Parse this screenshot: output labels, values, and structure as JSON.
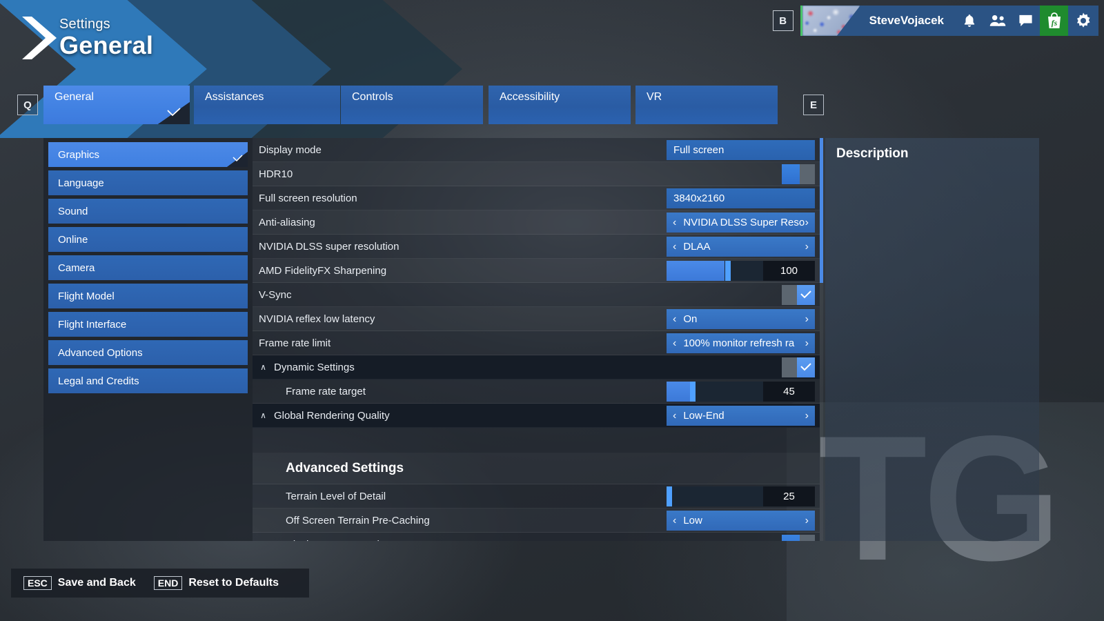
{
  "header": {
    "subtitle": "Settings",
    "title": "General"
  },
  "userbar": {
    "key_b": "B",
    "username": "SteveVojacek",
    "icons": [
      {
        "name": "bell-icon",
        "glyph": "☉"
      },
      {
        "name": "friends-icon",
        "glyph": "☉"
      },
      {
        "name": "chat-icon",
        "glyph": "☉"
      },
      {
        "name": "store-icon",
        "glyph": "fs"
      },
      {
        "name": "gear-icon",
        "glyph": "⚙"
      }
    ]
  },
  "tabs": {
    "key_prev": "Q",
    "key_next": "E",
    "items": [
      {
        "label": "General",
        "active": true
      },
      {
        "label": "Assistances",
        "active": false
      },
      {
        "label": "Controls",
        "active": false
      },
      {
        "label": "Accessibility",
        "active": false
      },
      {
        "label": "VR",
        "active": false
      }
    ]
  },
  "sidebar": {
    "items": [
      {
        "label": "Graphics",
        "active": true
      },
      {
        "label": "Language",
        "active": false
      },
      {
        "label": "Sound",
        "active": false
      },
      {
        "label": "Online",
        "active": false
      },
      {
        "label": "Camera",
        "active": false
      },
      {
        "label": "Flight Model",
        "active": false
      },
      {
        "label": "Flight Interface",
        "active": false
      },
      {
        "label": "Advanced Options",
        "active": false
      },
      {
        "label": "Legal and Credits",
        "active": false
      }
    ]
  },
  "settings": [
    {
      "label": "Display mode",
      "type": "value",
      "value": "Full screen"
    },
    {
      "label": "HDR10",
      "type": "toggle",
      "state": "off"
    },
    {
      "label": "Full screen resolution",
      "type": "value",
      "value": "3840x2160"
    },
    {
      "label": "Anti-aliasing",
      "type": "spinner",
      "value": "NVIDIA DLSS Super Reso"
    },
    {
      "label": "NVIDIA DLSS super resolution",
      "type": "spinner",
      "value": "DLAA"
    },
    {
      "label": "AMD FidelityFX Sharpening",
      "type": "slider",
      "value": "100",
      "fill_pct": 60,
      "knob_pct": 61
    },
    {
      "label": "V-Sync",
      "type": "toggle",
      "state": "on"
    },
    {
      "label": "NVIDIA reflex low latency",
      "type": "spinner",
      "value": "On"
    },
    {
      "label": "Frame rate limit",
      "type": "spinner",
      "value": "100% monitor refresh ra"
    },
    {
      "label": "Dynamic Settings",
      "type": "toggle",
      "state": "on",
      "group": true,
      "caret": "∧"
    },
    {
      "label": "Frame rate target",
      "type": "slider",
      "value": "45",
      "fill_pct": 24,
      "knob_pct": 24,
      "indent": 1
    },
    {
      "label": "Global Rendering Quality",
      "type": "spinner",
      "value": "Low-End",
      "group": true,
      "caret": "∧"
    },
    {
      "label": "",
      "type": "spacer"
    },
    {
      "label": "Advanced Settings",
      "type": "section"
    },
    {
      "label": "Terrain Level of Detail",
      "type": "slider",
      "value": "25",
      "fill_pct": 0,
      "knob_pct": 0,
      "indent": 1
    },
    {
      "label": "Off Screen Terrain Pre-Caching",
      "type": "spinner",
      "value": "Low",
      "indent": 1
    },
    {
      "label": "Displacement Mapping",
      "type": "toggle",
      "state": "off",
      "indent": 1
    }
  ],
  "description": {
    "title": "Description",
    "body": ""
  },
  "watermark": {
    "text": "TG"
  },
  "footer": {
    "actions": [
      {
        "key": "ESC",
        "label": "Save and Back"
      },
      {
        "key": "END",
        "label": "Reset to Defaults"
      }
    ]
  },
  "colors": {
    "accent": "#4d8ae8",
    "tab_inactive": "#2a5ca4",
    "store_green": "#1f8b2e",
    "panel_dark": "#151c26"
  }
}
